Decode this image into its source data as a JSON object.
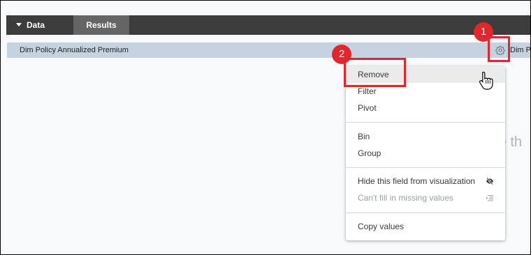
{
  "tabs": {
    "data": "Data",
    "results": "Results"
  },
  "field_row": {
    "label": "Dim Policy Annualized Premium",
    "truncated_next": "Dim P"
  },
  "background_text": "re th",
  "context_menu": {
    "items": [
      {
        "label": "Remove"
      },
      {
        "label": "Filter"
      },
      {
        "label": "Pivot"
      },
      {
        "label": "Bin"
      },
      {
        "label": "Group"
      },
      {
        "label": "Hide this field from visualization",
        "icon": "eye-slash-icon"
      },
      {
        "label": "Can't fill in missing values",
        "icon": "fill-values-icon",
        "disabled": true
      },
      {
        "label": "Copy values"
      }
    ]
  },
  "annotations": {
    "badge1": "1",
    "badge2": "2"
  },
  "colors": {
    "topbar": "#3c3c3c",
    "active_tab": "#656565",
    "field_row": "#c5d3e0",
    "annotation_red": "#e3262c",
    "menu_highlight": "#ebebeb"
  }
}
